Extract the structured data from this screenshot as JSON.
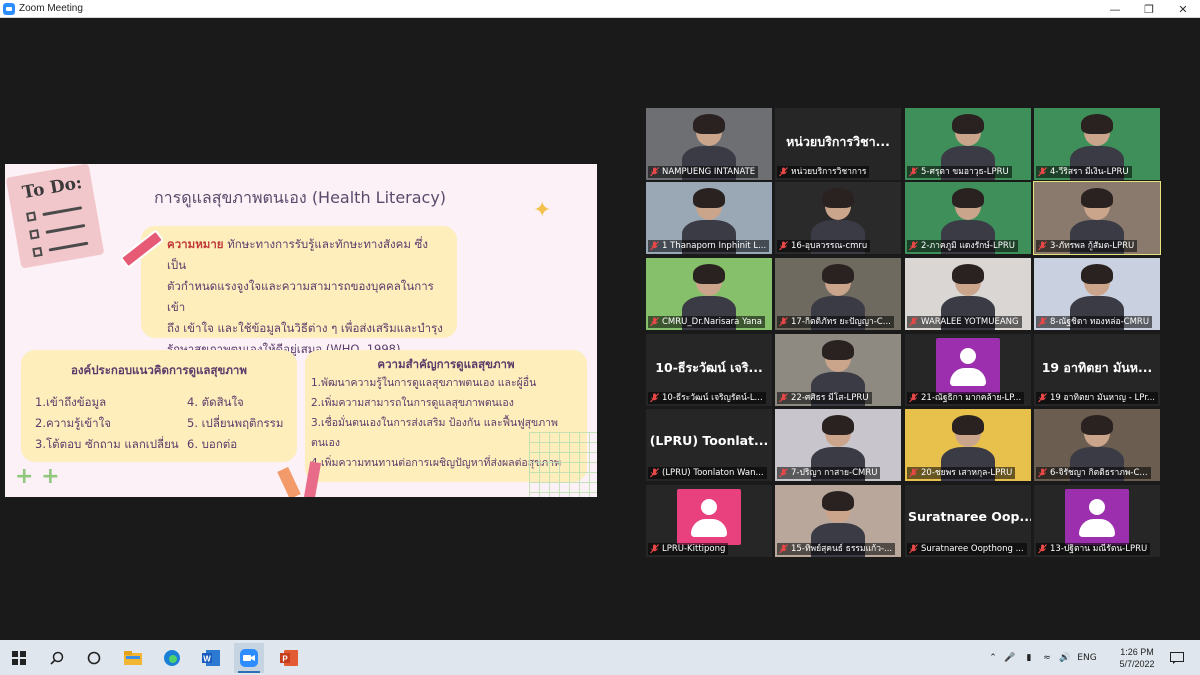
{
  "window": {
    "title": "Zoom Meeting"
  },
  "slide": {
    "todo_text": "To Do:",
    "title": "การดูแลสุขภาพตนเอง (Health Literacy)",
    "definition_head": "ความหมาย",
    "definition_lines": [
      "ทักษะทางการรับรู้และทักษะทางสังคม ซึ่งเป็น",
      "ตัวกำหนดแรงจูงใจและความสามารถของบุคคลในการเข้า",
      "ถึง เข้าใจ และใช้ข้อมูลในวิธีต่าง ๆ เพื่อส่งเสริมและบำรุง",
      "รักษาสุขภาพตนเองให้ดีอยู่เสมอ (WHO, 1998)"
    ],
    "left_box": {
      "header": "องค์ประกอบแนวคิดการดูแลสุขภาพ",
      "items": [
        "1.เข้าถึงข้อมูล",
        "2.ความรู้เข้าใจ",
        "3.โต้ตอบ ซักถาม แลกเปลี่ยน",
        "4. ตัดสินใจ",
        "5. เปลี่ยนพฤติกรรม",
        "6. บอกต่อ"
      ]
    },
    "right_box": {
      "header": "ความสำคัญการดูแลสุขภาพ",
      "items": [
        "1.พัฒนาความรู้ในการดูแลสุขภาพตนเอง และผู้อื่น",
        "2.เพิ่มความสามารถในการดูแลสุขภาพตนเอง",
        "3.เชื่อมั่นตนเองในการส่งเสริม ป้องกัน และฟื้นฟูสุขภาพ",
        "ตนเอง",
        "4.เพิ่มความทนทานต่อการเผชิญปัญหาที่ส่งผลต่อสุขภาพ"
      ]
    }
  },
  "participants": [
    {
      "label": "NAMPUENG INTANATE",
      "type": "video",
      "bg": "#6d6f73"
    },
    {
      "label": "หน่วยบริการวิชาการ",
      "type": "name",
      "name_text": "หน่วยบริการวิชา..."
    },
    {
      "label": "5-ศรุตา ขมอาวุธ-LPRU",
      "type": "video",
      "bg": "#3f8f5a"
    },
    {
      "label": "4-วีริสรา มีเงิน-LPRU",
      "type": "video",
      "bg": "#3f8f5a"
    },
    {
      "label": "1 Thanaporn Inphinit L...",
      "type": "video",
      "bg": "#9aa7b5"
    },
    {
      "label": "16-อุบลวรรณ-cmru",
      "type": "video",
      "bg": "#2a2a2a"
    },
    {
      "label": "2-ภาคภูมิ แดงรักษ์-LPRU",
      "type": "video",
      "bg": "#3f8f5a"
    },
    {
      "label": "3-ภัทรพล กู้สัมต-LPRU",
      "type": "video",
      "bg": "#8a7a6e"
    },
    {
      "label": "CMRU_Dr.Narisara Yana",
      "type": "video",
      "bg": "#86c06a"
    },
    {
      "label": "17-กิตติภัทร ยะปัญญา-C...",
      "type": "video",
      "bg": "#6f6a60"
    },
    {
      "label": "WARALEE YOTMUEANG",
      "type": "video",
      "bg": "#d9d6d3"
    },
    {
      "label": "8-ณัฐชิดา ทองหล่อ-CMRU",
      "type": "video",
      "bg": "#c9d1e0"
    },
    {
      "label": "10-ธีระวัฒน์ เจริญรัตน์-L...",
      "type": "name",
      "name_text": "10-ธีระวัฒน์ เจริ..."
    },
    {
      "label": "22-ศศิธร มีโส-LPRU",
      "type": "video",
      "bg": "#8e8a82"
    },
    {
      "label": "21-ณัฐธิกา มากคล้าย-LP...",
      "type": "avatar",
      "color": "#9b2fae"
    },
    {
      "label": "19 อาทิตยา มันหาญ - LPr...",
      "type": "name",
      "name_text": "19 อาทิตยา มันห..."
    },
    {
      "label": "(LPRU) Toonlaton Wan...",
      "type": "name",
      "name_text": "(LPRU) Toonlat..."
    },
    {
      "label": "7-ปริญา กาสาย-CMRU",
      "type": "video",
      "bg": "#c8c6cc"
    },
    {
      "label": "20-ชยพร เสาหกุล-LPRU",
      "type": "video",
      "bg": "#e7c14c"
    },
    {
      "label": "6-จิรัชญา กิตติธราภพ-C...",
      "type": "video",
      "bg": "#6b5e50"
    },
    {
      "label": "LPRU-Kittipong",
      "type": "avatar",
      "color": "#e8417e"
    },
    {
      "label": "15-ทิพย์สุคนธ์ ธรรมแก้ว-...",
      "type": "video",
      "bg": "#b8a79a"
    },
    {
      "label": "Suratnaree Oopthong ...",
      "type": "name",
      "name_text": "Suratnaree Oop..."
    },
    {
      "label": "13-ปฐิตาน มณีรัตน-LPRU",
      "type": "avatar",
      "color": "#9b2fae"
    }
  ],
  "taskbar": {
    "language": "ENG",
    "time": "1:26 PM",
    "date": "5/7/2022"
  }
}
